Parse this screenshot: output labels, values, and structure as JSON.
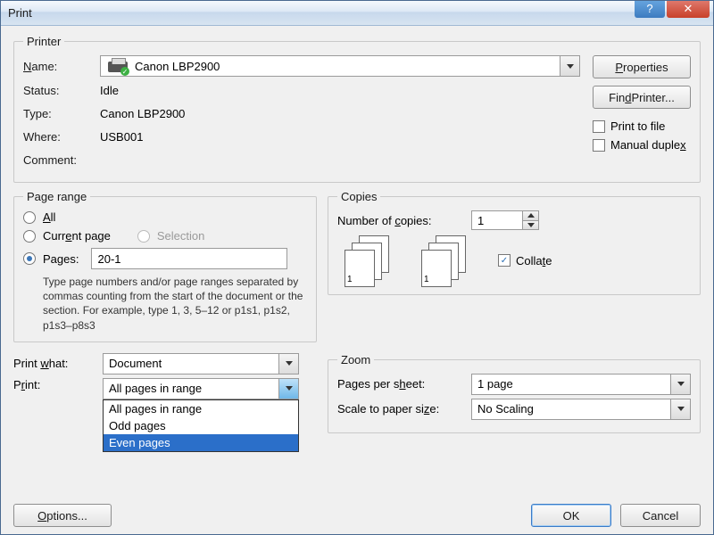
{
  "title": "Print",
  "printer": {
    "legend": "Printer",
    "name_label": "Name:",
    "name_value": "Canon LBP2900",
    "status_label": "Status:",
    "status_value": "Idle",
    "type_label": "Type:",
    "type_value": "Canon LBP2900",
    "where_label": "Where:",
    "where_value": "USB001",
    "comment_label": "Comment:",
    "properties_btn": "Properties",
    "find_printer_btn": "Find Printer...",
    "print_to_file": "Print to file",
    "manual_duplex": "Manual duplex"
  },
  "page_range": {
    "legend": "Page range",
    "all": "All",
    "current": "Current page",
    "selection": "Selection",
    "pages_label": "Pages:",
    "pages_value": "20-1",
    "hint": "Type page numbers and/or page ranges separated by commas counting from the start of the document or the section. For example, type 1, 3, 5–12 or p1s1, p1s2, p1s3–p8s3"
  },
  "copies": {
    "legend": "Copies",
    "num_label": "Number of copies:",
    "num_value": "1",
    "collate": "Collate"
  },
  "print_what_label": "Print what:",
  "print_what_value": "Document",
  "print_label": "Print:",
  "print_value": "All pages in range",
  "print_options": {
    "o0": "All pages in range",
    "o1": "Odd pages",
    "o2": "Even pages"
  },
  "zoom": {
    "legend": "Zoom",
    "pps_label": "Pages per sheet:",
    "pps_value": "1 page",
    "scale_label": "Scale to paper size:",
    "scale_value": "No Scaling"
  },
  "buttons": {
    "options": "Options...",
    "ok": "OK",
    "cancel": "Cancel"
  }
}
